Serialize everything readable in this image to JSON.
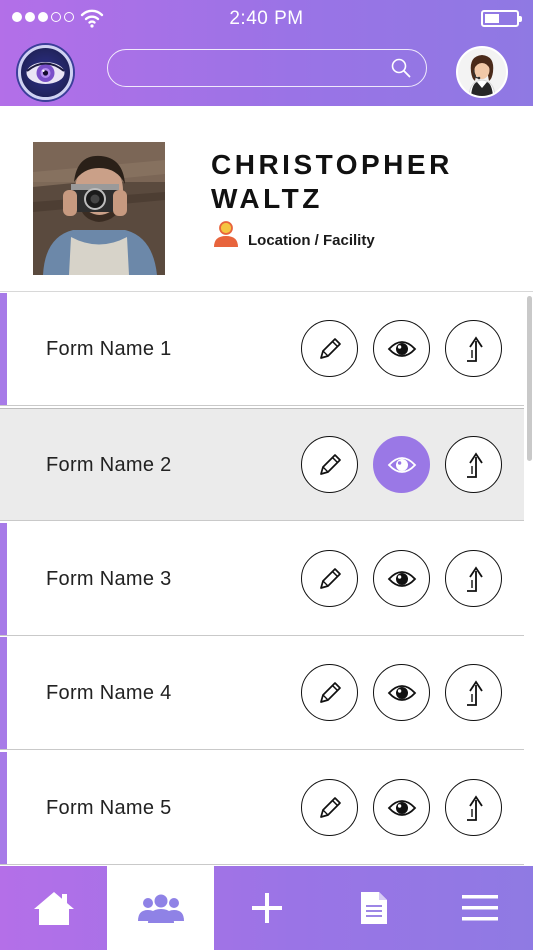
{
  "status_bar": {
    "time": "2:40 PM",
    "signal_dots_filled": 3,
    "signal_dots_total": 5,
    "battery_level": 0.4
  },
  "header": {
    "logo_icon": "eye-logo-icon",
    "search": {
      "value": "",
      "placeholder": "",
      "icon": "search-icon"
    },
    "avatar_icon": "support-agent-avatar"
  },
  "profile": {
    "name": "CHRISTOPHER WALTZ",
    "location_label": "Location / Facility",
    "location_icon": "person-location-icon"
  },
  "forms": [
    {
      "name": "Form Name 1",
      "active": false
    },
    {
      "name": "Form Name 2",
      "active": true
    },
    {
      "name": "Form Name 3",
      "active": false
    },
    {
      "name": "Form Name 4",
      "active": false
    },
    {
      "name": "Form Name 5",
      "active": false
    }
  ],
  "row_actions": [
    "pencil-icon",
    "eye-icon",
    "upload-arrow-icon"
  ],
  "bottom_nav": [
    {
      "icon": "home-icon",
      "active": false
    },
    {
      "icon": "group-icon",
      "active": true
    },
    {
      "icon": "plus-icon",
      "active": false
    },
    {
      "icon": "document-icon",
      "active": false
    },
    {
      "icon": "menu-icon",
      "active": false
    }
  ],
  "colors": {
    "accent": "#a77be8",
    "header_gradient_start": "#b36fe8",
    "header_gradient_end": "#8f79e3",
    "active_row_bg": "#ebebeb",
    "active_view_button": "#9a78e6"
  }
}
